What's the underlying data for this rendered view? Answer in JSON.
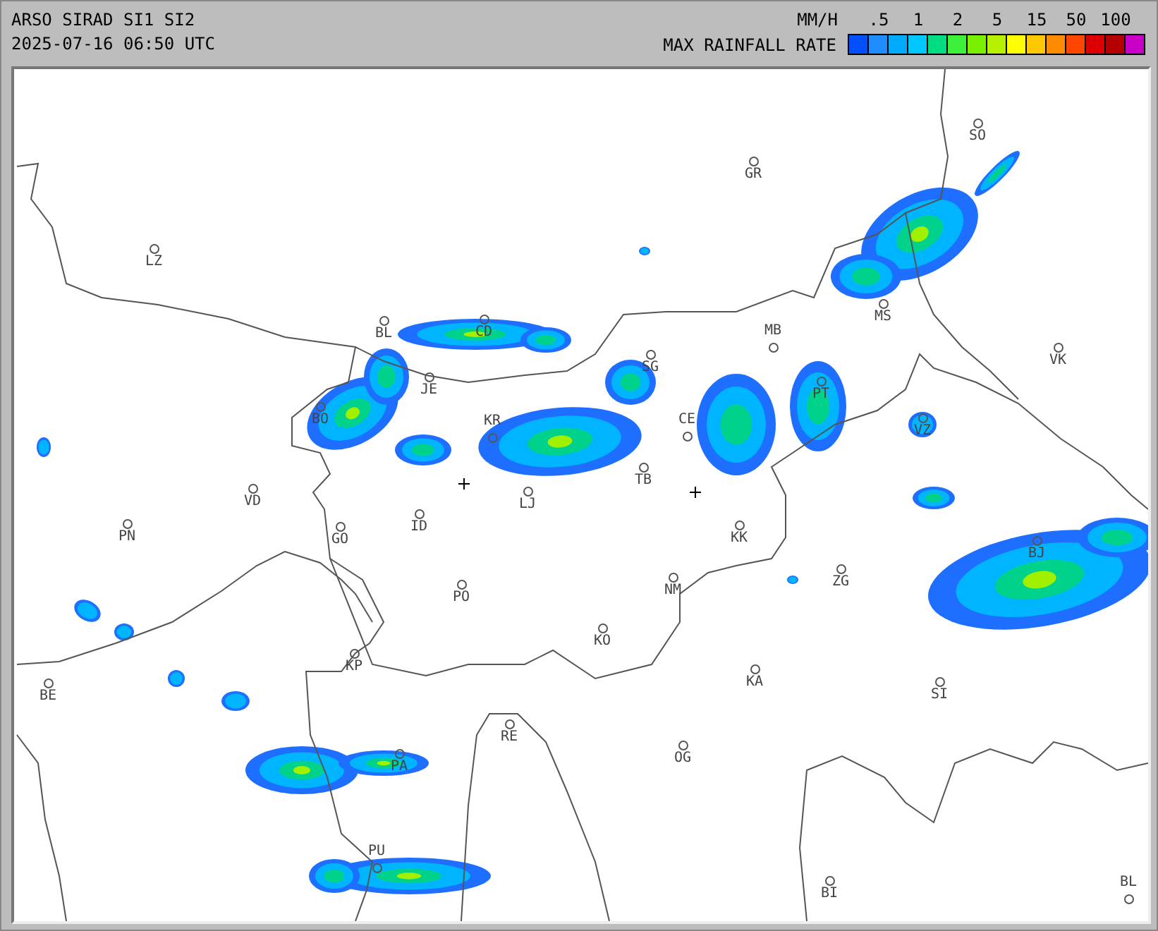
{
  "header": {
    "title": "ARSO SIRAD SI1 SI2",
    "timestamp": "2025-07-16 06:50 UTC"
  },
  "legend": {
    "unit": "MM/H",
    "caption": "MAX RAINFALL RATE",
    "ticks": [
      ".5",
      "1",
      "2",
      "5",
      "15",
      "50",
      "100"
    ],
    "scale": [
      {
        "color": "#0050ff"
      },
      {
        "color": "#1e8cff"
      },
      {
        "color": "#00aaff"
      },
      {
        "color": "#00c8ff"
      },
      {
        "color": "#00dc82"
      },
      {
        "color": "#3cf03c"
      },
      {
        "color": "#78f000"
      },
      {
        "color": "#b4f000"
      },
      {
        "color": "#ffff00"
      },
      {
        "color": "#ffc800"
      },
      {
        "color": "#ff8c00"
      },
      {
        "color": "#ff4600"
      },
      {
        "color": "#dc0000"
      },
      {
        "color": "#b40000"
      },
      {
        "color": "#c800c8"
      }
    ]
  },
  "map": {
    "places": [
      {
        "name": "LZ"
      },
      {
        "name": "GR"
      },
      {
        "name": "SO"
      },
      {
        "name": "BL"
      },
      {
        "name": "CD"
      },
      {
        "name": "MS"
      },
      {
        "name": "MB"
      },
      {
        "name": "VK"
      },
      {
        "name": "SG"
      },
      {
        "name": "JE"
      },
      {
        "name": "PT"
      },
      {
        "name": "BO"
      },
      {
        "name": "VZ"
      },
      {
        "name": "KR"
      },
      {
        "name": "CE"
      },
      {
        "name": "TB"
      },
      {
        "name": "LJ"
      },
      {
        "name": "VD"
      },
      {
        "name": "PN"
      },
      {
        "name": "ID"
      },
      {
        "name": "GO"
      },
      {
        "name": "KK"
      },
      {
        "name": "BJ"
      },
      {
        "name": "ZG"
      },
      {
        "name": "NM"
      },
      {
        "name": "PO"
      },
      {
        "name": "KO"
      },
      {
        "name": "KP"
      },
      {
        "name": "KA"
      },
      {
        "name": "SI"
      },
      {
        "name": "BE"
      },
      {
        "name": "RE"
      },
      {
        "name": "OG"
      },
      {
        "name": "PA"
      },
      {
        "name": "PU"
      },
      {
        "name": "BI"
      },
      {
        "name": "BL"
      }
    ]
  }
}
